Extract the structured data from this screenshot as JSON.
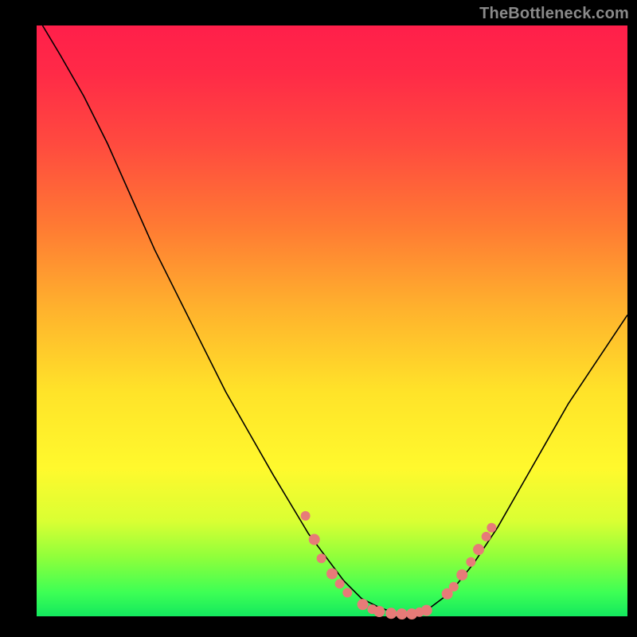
{
  "watermark": "TheBottleneck.com",
  "chart_data": {
    "type": "line",
    "title": "",
    "xlabel": "",
    "ylabel": "",
    "xlim": [
      0,
      1
    ],
    "ylim": [
      0,
      1
    ],
    "grid": false,
    "legend": false,
    "background_gradient": [
      "#ff1f4a",
      "#ff4a3f",
      "#ffb22d",
      "#fff92d",
      "#8fff3b",
      "#13e85e"
    ],
    "series": [
      {
        "name": "bottleneck-curve",
        "x": [
          0.01,
          0.04,
          0.08,
          0.12,
          0.16,
          0.2,
          0.24,
          0.28,
          0.32,
          0.36,
          0.4,
          0.43,
          0.46,
          0.49,
          0.52,
          0.55,
          0.58,
          0.6,
          0.62,
          0.64,
          0.66,
          0.7,
          0.74,
          0.78,
          0.82,
          0.86,
          0.9,
          0.94,
          0.98,
          1.0
        ],
        "y": [
          1.0,
          0.95,
          0.88,
          0.8,
          0.71,
          0.62,
          0.54,
          0.46,
          0.38,
          0.31,
          0.24,
          0.19,
          0.14,
          0.1,
          0.06,
          0.03,
          0.015,
          0.008,
          0.004,
          0.004,
          0.01,
          0.04,
          0.09,
          0.15,
          0.22,
          0.29,
          0.36,
          0.42,
          0.48,
          0.51
        ],
        "color": "#000000"
      }
    ],
    "scatter": {
      "name": "scatter-points",
      "color": "#e77b78",
      "points": [
        {
          "x": 0.455,
          "y": 0.17,
          "r": 6
        },
        {
          "x": 0.47,
          "y": 0.13,
          "r": 7
        },
        {
          "x": 0.482,
          "y": 0.098,
          "r": 6
        },
        {
          "x": 0.5,
          "y": 0.072,
          "r": 7
        },
        {
          "x": 0.513,
          "y": 0.055,
          "r": 6
        },
        {
          "x": 0.526,
          "y": 0.04,
          "r": 6
        },
        {
          "x": 0.552,
          "y": 0.02,
          "r": 7
        },
        {
          "x": 0.568,
          "y": 0.012,
          "r": 6
        },
        {
          "x": 0.58,
          "y": 0.008,
          "r": 7
        },
        {
          "x": 0.6,
          "y": 0.005,
          "r": 7
        },
        {
          "x": 0.618,
          "y": 0.004,
          "r": 7
        },
        {
          "x": 0.635,
          "y": 0.004,
          "r": 7
        },
        {
          "x": 0.648,
          "y": 0.007,
          "r": 6
        },
        {
          "x": 0.66,
          "y": 0.01,
          "r": 7
        },
        {
          "x": 0.695,
          "y": 0.038,
          "r": 7
        },
        {
          "x": 0.706,
          "y": 0.05,
          "r": 6
        },
        {
          "x": 0.72,
          "y": 0.07,
          "r": 7
        },
        {
          "x": 0.735,
          "y": 0.092,
          "r": 6
        },
        {
          "x": 0.748,
          "y": 0.113,
          "r": 7
        },
        {
          "x": 0.761,
          "y": 0.135,
          "r": 6
        },
        {
          "x": 0.77,
          "y": 0.15,
          "r": 6
        }
      ]
    }
  }
}
